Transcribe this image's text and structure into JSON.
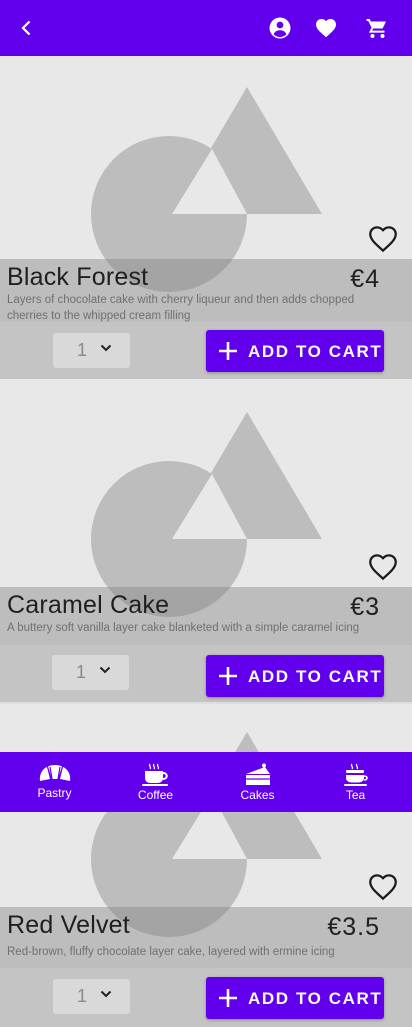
{
  "appbar": {
    "back_icon": "back-arrow-icon",
    "actions": [
      "account-circle-icon",
      "favorite-icon",
      "shopping-cart-icon"
    ],
    "color": "#6200ee"
  },
  "products": [
    {
      "name": "Black Forest",
      "price": "€4",
      "description": "Layers of chocolate cake with cherry liqueur and then adds chopped cherries to the whipped cream filling",
      "quantity": "1",
      "add_label": "ADD TO CART"
    },
    {
      "name": "Caramel Cake",
      "price": "€3",
      "description": "A buttery soft vanilla layer cake blanketed with a simple  caramel icing",
      "quantity": "1",
      "add_label": "ADD TO CART"
    },
    {
      "name": "Red Velvet",
      "price": "€3.5",
      "description": "Red-brown,  fluffy chocolate layer cake, layered with ermine icing",
      "quantity": "1",
      "add_label": "ADD TO CART"
    }
  ],
  "categories": [
    {
      "label": "Pastry",
      "icon": "croissant-icon"
    },
    {
      "label": "Coffee",
      "icon": "coffee-cup-icon"
    },
    {
      "label": "Cakes",
      "icon": "cake-slice-icon"
    },
    {
      "label": "Tea",
      "icon": "tea-cup-icon"
    }
  ],
  "colors": {
    "primary": "#6200ee",
    "placeholder_shape": "#bdbdbd",
    "placeholder_bg": "#e8e8e8"
  }
}
